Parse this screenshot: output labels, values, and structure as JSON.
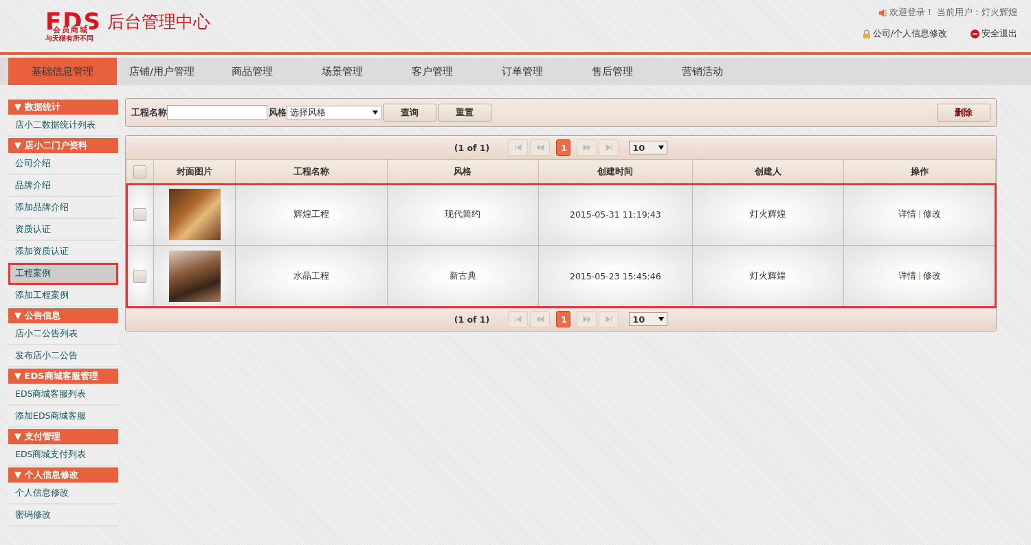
{
  "header": {
    "logo": {
      "letters": "EDS",
      "subtitle": "会员商城",
      "tagline": "与天猫有所不同"
    },
    "title": "后台管理中心",
    "welcome": "欢迎登录！ 当前用户：灯火辉煌",
    "links": [
      {
        "kind": "lock",
        "label": "公司/个人信息修改"
      },
      {
        "kind": "exit",
        "label": "安全退出"
      }
    ]
  },
  "nav": [
    {
      "label": "基础信息管理",
      "selected": true
    },
    {
      "label": "店铺/用户管理",
      "selected": false
    },
    {
      "label": "商品管理",
      "selected": false
    },
    {
      "label": "场景管理",
      "selected": false
    },
    {
      "label": "客户管理",
      "selected": false
    },
    {
      "label": "订单管理",
      "selected": false
    },
    {
      "label": "售后管理",
      "selected": false
    },
    {
      "label": "营销活动",
      "selected": false
    }
  ],
  "sidebar": [
    {
      "title": "▼ 数据统计",
      "items": [
        {
          "label": "店小二数据统计列表",
          "selected": false
        }
      ]
    },
    {
      "title": "▼ 店小二门户资料",
      "items": [
        {
          "label": "公司介绍",
          "selected": false
        },
        {
          "label": "品牌介绍",
          "selected": false
        },
        {
          "label": "添加品牌介绍",
          "selected": false
        },
        {
          "label": "资质认证",
          "selected": false
        },
        {
          "label": "添加资质认证",
          "selected": false
        },
        {
          "label": "工程案例",
          "selected": true
        },
        {
          "label": "添加工程案例",
          "selected": false
        }
      ]
    },
    {
      "title": "▼ 公告信息",
      "items": [
        {
          "label": "店小二公告列表",
          "selected": false
        },
        {
          "label": "发布店小二公告",
          "selected": false
        }
      ]
    },
    {
      "title": "▼ EDS商城客服管理",
      "items": [
        {
          "label": "EDS商城客服列表",
          "selected": false
        },
        {
          "label": "添加EDS商城客服",
          "selected": false
        }
      ]
    },
    {
      "title": "▼ 支付管理",
      "items": [
        {
          "label": "EDS商城支付列表",
          "selected": false
        }
      ]
    },
    {
      "title": "▼ 个人信息修改",
      "items": [
        {
          "label": "个人信息修改",
          "selected": false
        },
        {
          "label": "密码修改",
          "selected": false
        }
      ]
    }
  ],
  "filter": {
    "name_label": "工程名称",
    "style_label": "风格",
    "style_value": "选择风格",
    "buttons": [
      "查询",
      "重置"
    ],
    "delete_button": "删除"
  },
  "pagers": [
    {
      "summary": "(1 of 1)",
      "pages": [
        {
          "label": "1",
          "selected": true
        }
      ],
      "page_size": "10"
    },
    {
      "summary": "(1 of 1)",
      "pages": [
        {
          "label": "1",
          "selected": true
        }
      ],
      "page_size": "10"
    }
  ],
  "table": {
    "columns": [
      "封面图片",
      "工程名称",
      "风格",
      "创建时间",
      "创建人",
      "操作"
    ],
    "all_checked": false,
    "body_highlighted": true,
    "rows": [
      {
        "checked": false,
        "name": "辉煌工程",
        "style": "现代简约",
        "created": "2015-05-31 11:19:43",
        "creator": "灯火辉煌",
        "actions": [
          "详情",
          "修改"
        ],
        "action_separator": "|"
      },
      {
        "checked": false,
        "name": "水晶工程",
        "style": "新古典",
        "created": "2015-05-23 15:45:46",
        "creator": "灯火辉煌",
        "actions": [
          "详情",
          "修改"
        ],
        "action_separator": "|"
      }
    ]
  }
}
